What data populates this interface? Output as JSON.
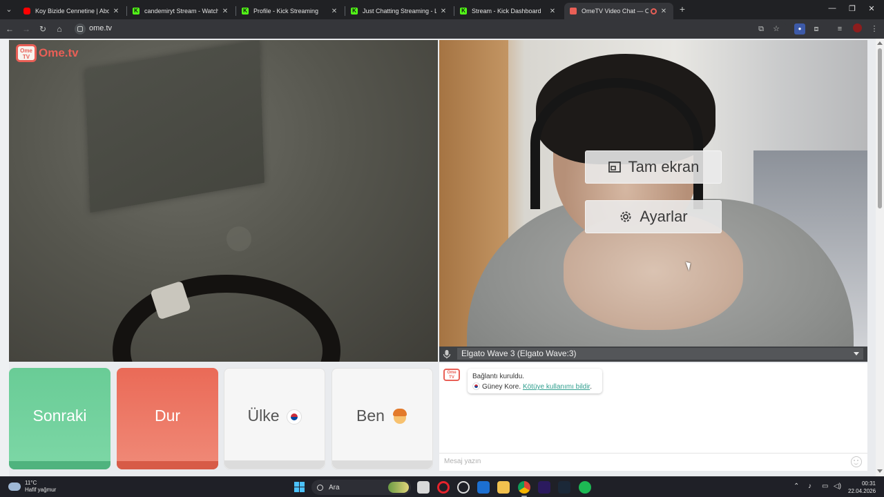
{
  "browser": {
    "tabs": [
      {
        "title": "Koy Bizide Cennetine | Abdurra",
        "favicon": "youtube-icon",
        "color": "#ff0000"
      },
      {
        "title": "candemiryt Stream - Watch Liv",
        "favicon": "kick-icon",
        "color": "#53fc18"
      },
      {
        "title": "Profile - Kick Streaming",
        "favicon": "kick-icon",
        "color": "#53fc18"
      },
      {
        "title": "Just Chatting Streaming - Live S",
        "favicon": "kick-icon",
        "color": "#53fc18"
      },
      {
        "title": "Stream - Kick Dashboard",
        "favicon": "kick-icon",
        "color": "#53fc18"
      },
      {
        "title": "OmeTV Video Chat — Ome",
        "favicon": "ometv-icon",
        "color": "#e95f56",
        "active": true
      }
    ],
    "url": "ome.tv"
  },
  "page": {
    "logo_text": "Ome.tv",
    "logo_badge": "Ome TV",
    "fullscreen_label": "Tam ekran",
    "settings_label": "Ayarlar",
    "microphone": "Elgato Wave 3 (Elgato Wave:3)",
    "buttons": {
      "next": "Sonraki",
      "stop": "Dur",
      "country": "Ülke",
      "me": "Ben"
    },
    "chat": {
      "status": "Bağlantı kuruldu.",
      "country": "Güney Kore.",
      "report_link": "Kötüye kullanımı bildir",
      "input_placeholder": "Mesaj yazın"
    },
    "colors": {
      "next": "#69cc96",
      "stop": "#ea6a57",
      "brand": "#e95f56"
    }
  },
  "taskbar": {
    "temperature": "11°C",
    "weather": "Hafif yağmur",
    "search_placeholder": "Ara",
    "time": "00:31",
    "date": "22.04.2026"
  }
}
